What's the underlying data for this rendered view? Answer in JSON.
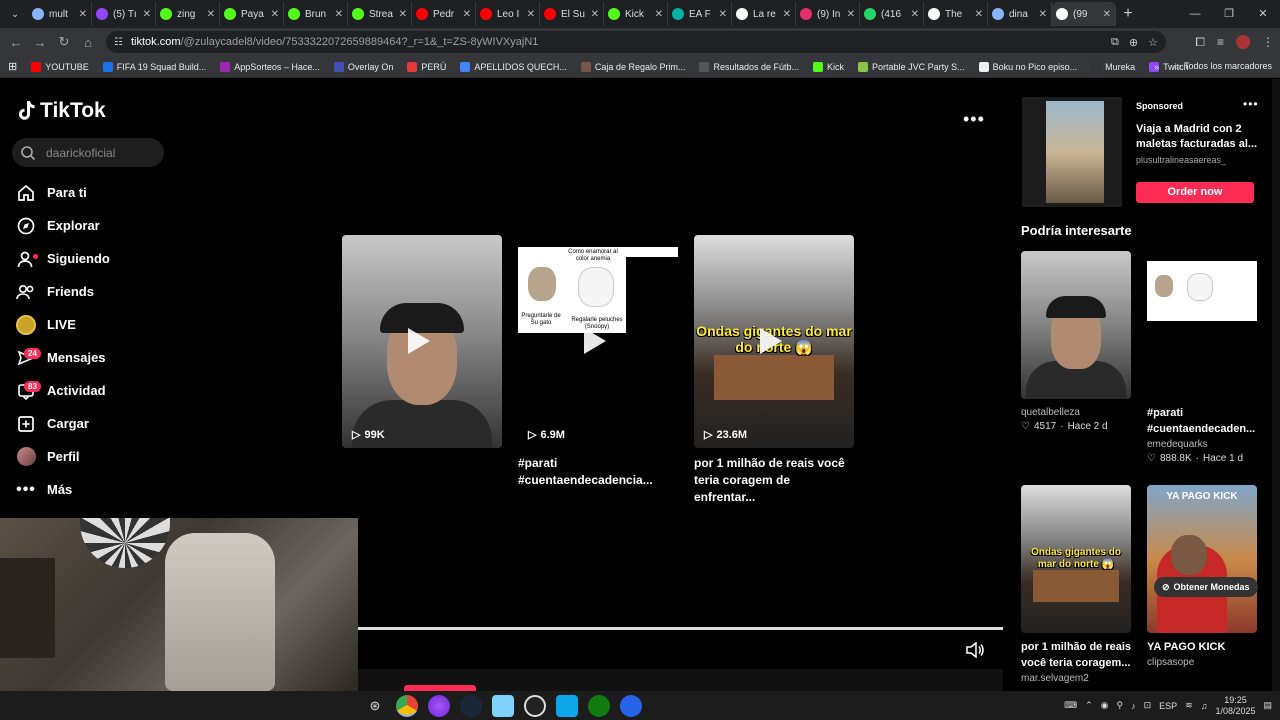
{
  "browser": {
    "tabs": [
      {
        "label": "mult",
        "color": "#8ab4f8"
      },
      {
        "label": "(5) Tı",
        "color": "#9146ff"
      },
      {
        "label": "zing",
        "color": "#53fc18"
      },
      {
        "label": "Paya",
        "color": "#53fc18"
      },
      {
        "label": "Brun",
        "color": "#53fc18"
      },
      {
        "label": "Strea",
        "color": "#53fc18"
      },
      {
        "label": "Pedr",
        "color": "#ff0000"
      },
      {
        "label": "Leo I",
        "color": "#ff0000"
      },
      {
        "label": "El Su",
        "color": "#ff0000"
      },
      {
        "label": "Kick",
        "color": "#53fc18"
      },
      {
        "label": "EA F",
        "color": "#00b3a4"
      },
      {
        "label": "La re",
        "color": "#ffffff"
      },
      {
        "label": "(9) In",
        "color": "#e1306c"
      },
      {
        "label": "(416",
        "color": "#25d366"
      },
      {
        "label": "The",
        "color": "#ffffff"
      },
      {
        "label": "dina",
        "color": "#8ab4f8"
      },
      {
        "label": "(99",
        "color": "#ffffff"
      }
    ],
    "url_host": "tiktok.com",
    "url_path": "/@zulaycadel8/video/7533322072659889464?_r=1&_t=ZS-8yWIVXyajN1",
    "bookmarks": [
      {
        "label": "YOUTUBE",
        "color": "#ff0000"
      },
      {
        "label": "FIFA 19 Squad Build...",
        "color": "#1a73e8"
      },
      {
        "label": "AppSorteos – Hace...",
        "color": "#9c27b0"
      },
      {
        "label": "Overlay On",
        "color": "#3f51b5"
      },
      {
        "label": "PERÚ",
        "color": "#e53935"
      },
      {
        "label": "APELLIDOS QUECH...",
        "color": "#4285f4"
      },
      {
        "label": "Caja de Regalo Prim...",
        "color": "#795548"
      },
      {
        "label": "Resultados de Fútb...",
        "color": "#555555"
      },
      {
        "label": "Kick",
        "color": "#53fc18"
      },
      {
        "label": "Portable JVC Party S...",
        "color": "#8bc34a"
      },
      {
        "label": "Boku no Pico episo...",
        "color": "#eeeeee"
      },
      {
        "label": "Mureka",
        "color": "#333333"
      },
      {
        "label": "Twitch",
        "color": "#9146ff"
      }
    ],
    "all_bookmarks": "Todos los marcadores"
  },
  "tiktok": {
    "logo": "TikTok",
    "search_placeholder": "daarickoficial",
    "nav": [
      {
        "label": "Para ti",
        "icon": "home-icon"
      },
      {
        "label": "Explorar",
        "icon": "compass-icon"
      },
      {
        "label": "Siguiendo",
        "icon": "following-icon"
      },
      {
        "label": "Friends",
        "icon": "friends-icon"
      },
      {
        "label": "LIVE",
        "icon": "live-icon"
      },
      {
        "label": "Mensajes",
        "icon": "messages-icon",
        "badge": "24"
      },
      {
        "label": "Actividad",
        "icon": "activity-icon",
        "badge": "83"
      },
      {
        "label": "Cargar",
        "icon": "upload-icon"
      },
      {
        "label": "Perfil",
        "icon": "profile-icon"
      },
      {
        "label": "Más",
        "icon": "more-icon"
      }
    ],
    "videos": [
      {
        "views": "99K",
        "title": ""
      },
      {
        "views": "6.9M",
        "title": "#parati #cuentaendecadencia...",
        "meme_top": "Como enamorar al color anemia",
        "meme_left": "Preguntarle de Su gato",
        "meme_right": "Regalarle peluches (Snoopy)"
      },
      {
        "views": "23.6M",
        "title": "por 1 milhão de reais você teria coragem de enfrentar...",
        "overlay": "Ondas gigantes do mar do norte 😱"
      }
    ],
    "ad": {
      "sponsored": "Sponsored",
      "title": "Viaja a Madrid con 2 maletas facturadas al...",
      "domain": "plusultralineasaereas_",
      "cta": "Order now"
    },
    "recommend_title": "Podría interesarte",
    "recommendations": [
      {
        "name": "quetalbelleza",
        "likes": "4517",
        "time": "Hace 2 d",
        "title": ""
      },
      {
        "name": "emedequarks",
        "likes": "888.8K",
        "time": "Hace 1 d",
        "title": "#parati #cuentaendecaden..."
      },
      {
        "name": "mar.selvagem2",
        "title": "por 1 milhão de reais você teria coragem...",
        "overlay": "Ondas gigantes do mar do norte 😱"
      },
      {
        "name": "clipsasope",
        "title": "YA PAGO KICK",
        "overlay": "YA PAGO KICK"
      }
    ],
    "coins": "Obtener Monedas"
  },
  "taskbar": {
    "time": "19:25",
    "date": "1/08/2025",
    "lang": "ESP"
  }
}
